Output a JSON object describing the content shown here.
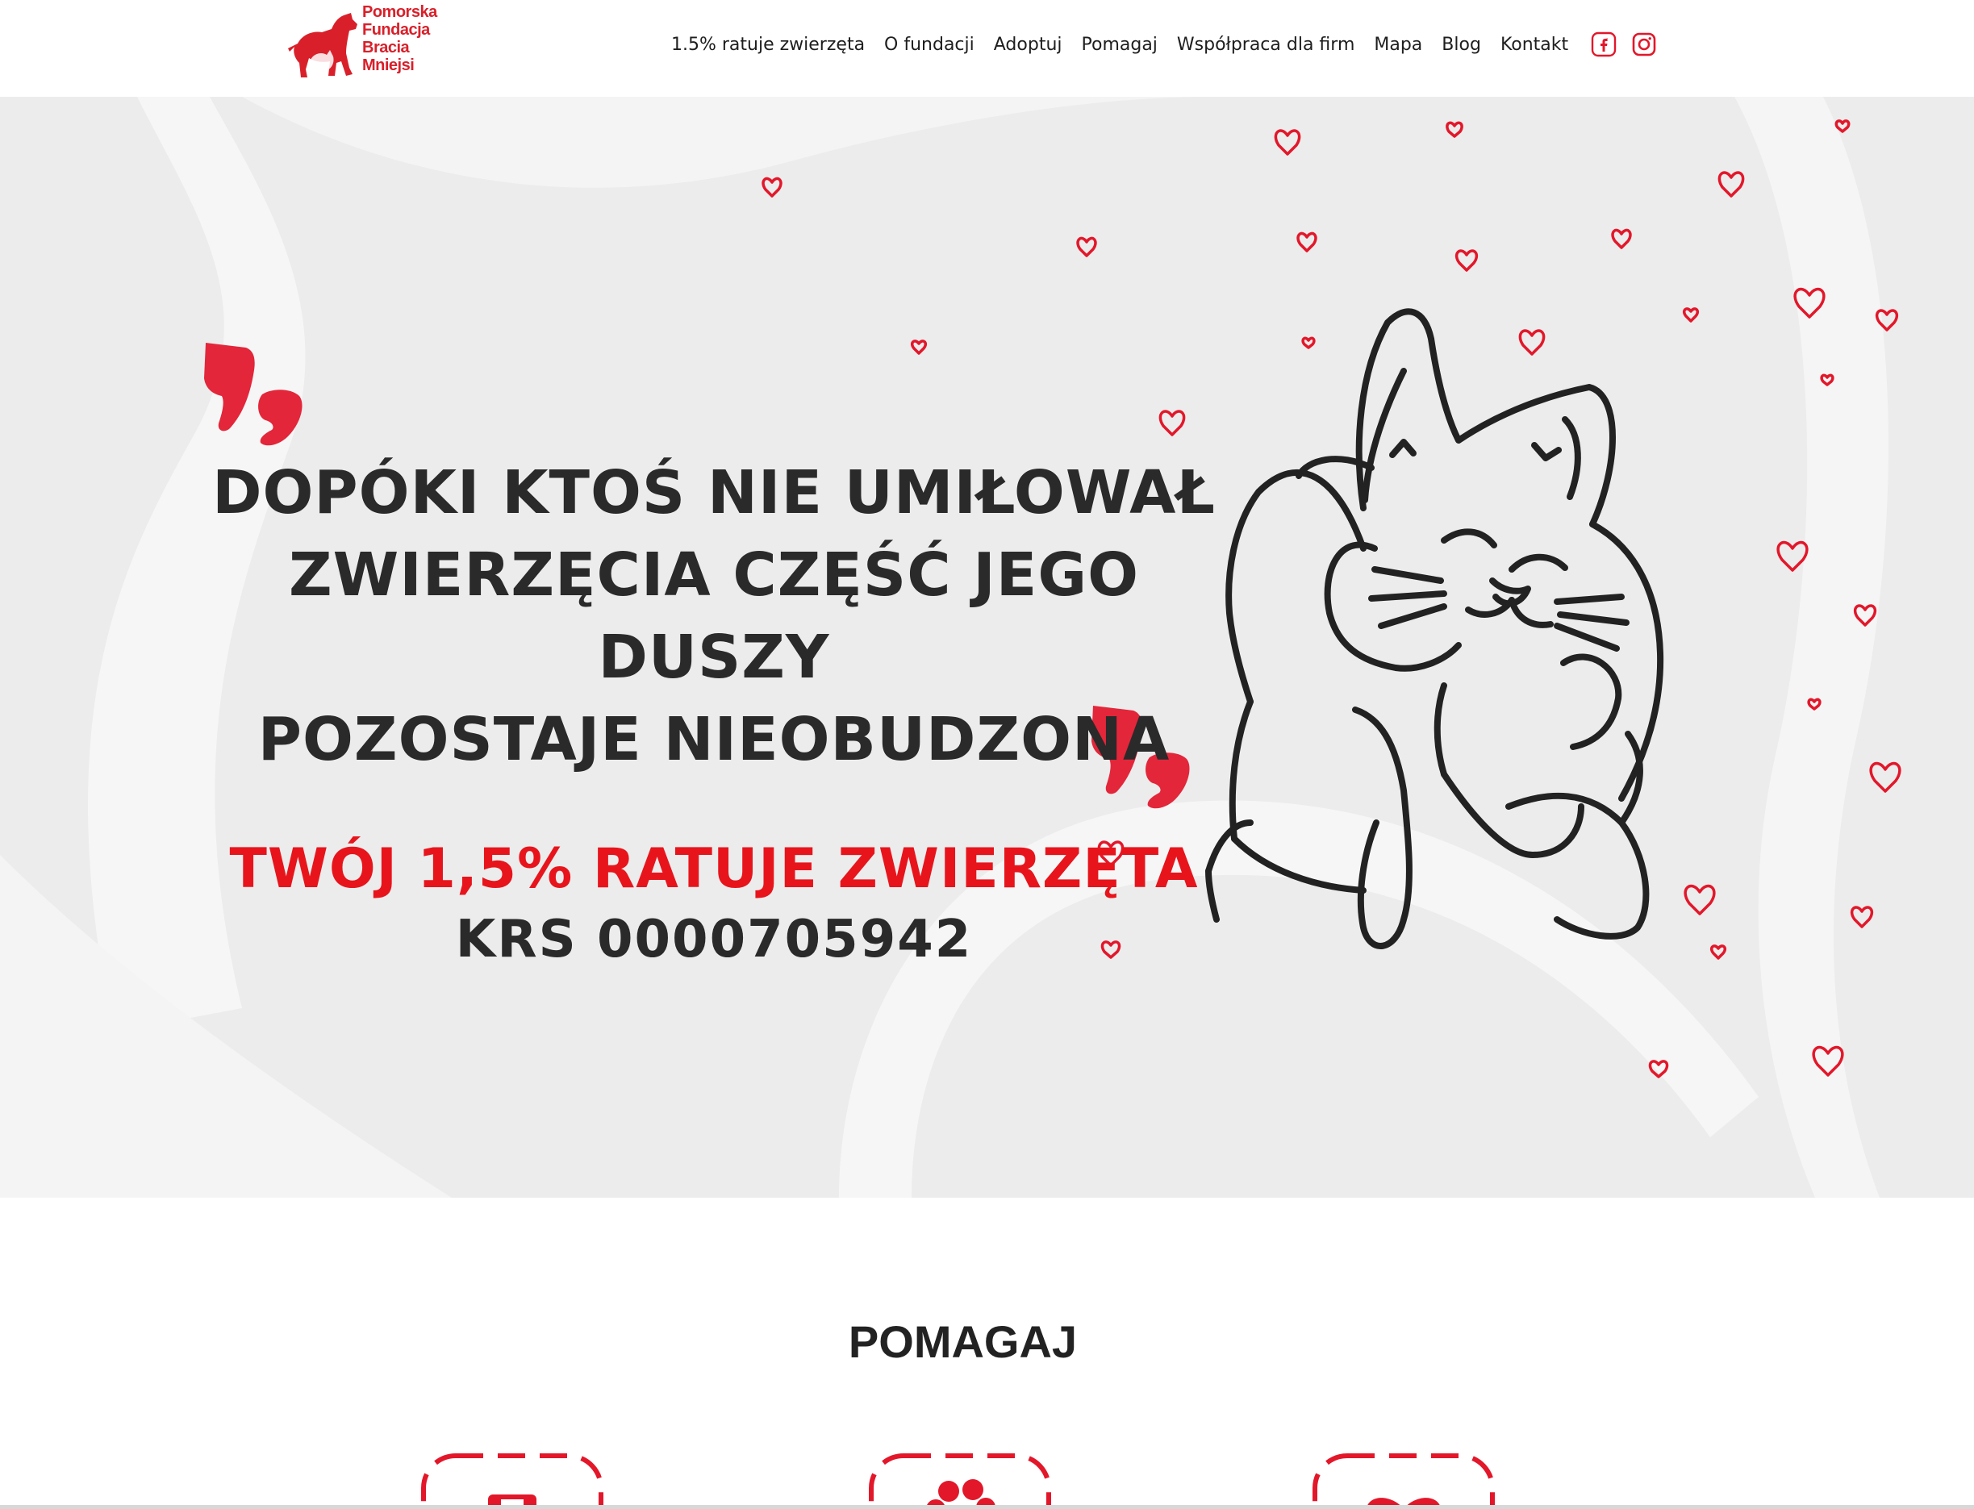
{
  "brand": {
    "logo_lines": [
      "Pomorska",
      "Fundacja",
      "Bracia",
      "Mniejsi"
    ],
    "color": "#d9202a"
  },
  "nav": {
    "items": [
      {
        "label": "1.5% ratuje zwierzęta"
      },
      {
        "label": "O fundacji"
      },
      {
        "label": "Adoptuj"
      },
      {
        "label": "Pomagaj"
      },
      {
        "label": "Współpraca dla firm"
      },
      {
        "label": "Mapa"
      },
      {
        "label": "Blog"
      },
      {
        "label": "Kontakt"
      }
    ],
    "social": [
      "facebook-icon",
      "instagram-icon"
    ]
  },
  "hero": {
    "quote_lines": [
      "Dopóki ktoś nie umiłował",
      "zwierzęcia część jego duszy",
      "pozostaje nieobudzona"
    ],
    "cta": "Twój 1,5% ratuje zwierzęta",
    "krs": "KRS 0000705942",
    "accent_color": "#e8141c",
    "text_color": "#2a2a2a",
    "background": "#ececec",
    "illustration": "cat-in-hands-line-art",
    "decor": "red-hearts"
  },
  "help_section": {
    "title": "POMAGAJ",
    "cards": [
      {
        "icon": "donate-icon"
      },
      {
        "icon": "paw-icon"
      },
      {
        "icon": "heart-icon"
      }
    ]
  }
}
